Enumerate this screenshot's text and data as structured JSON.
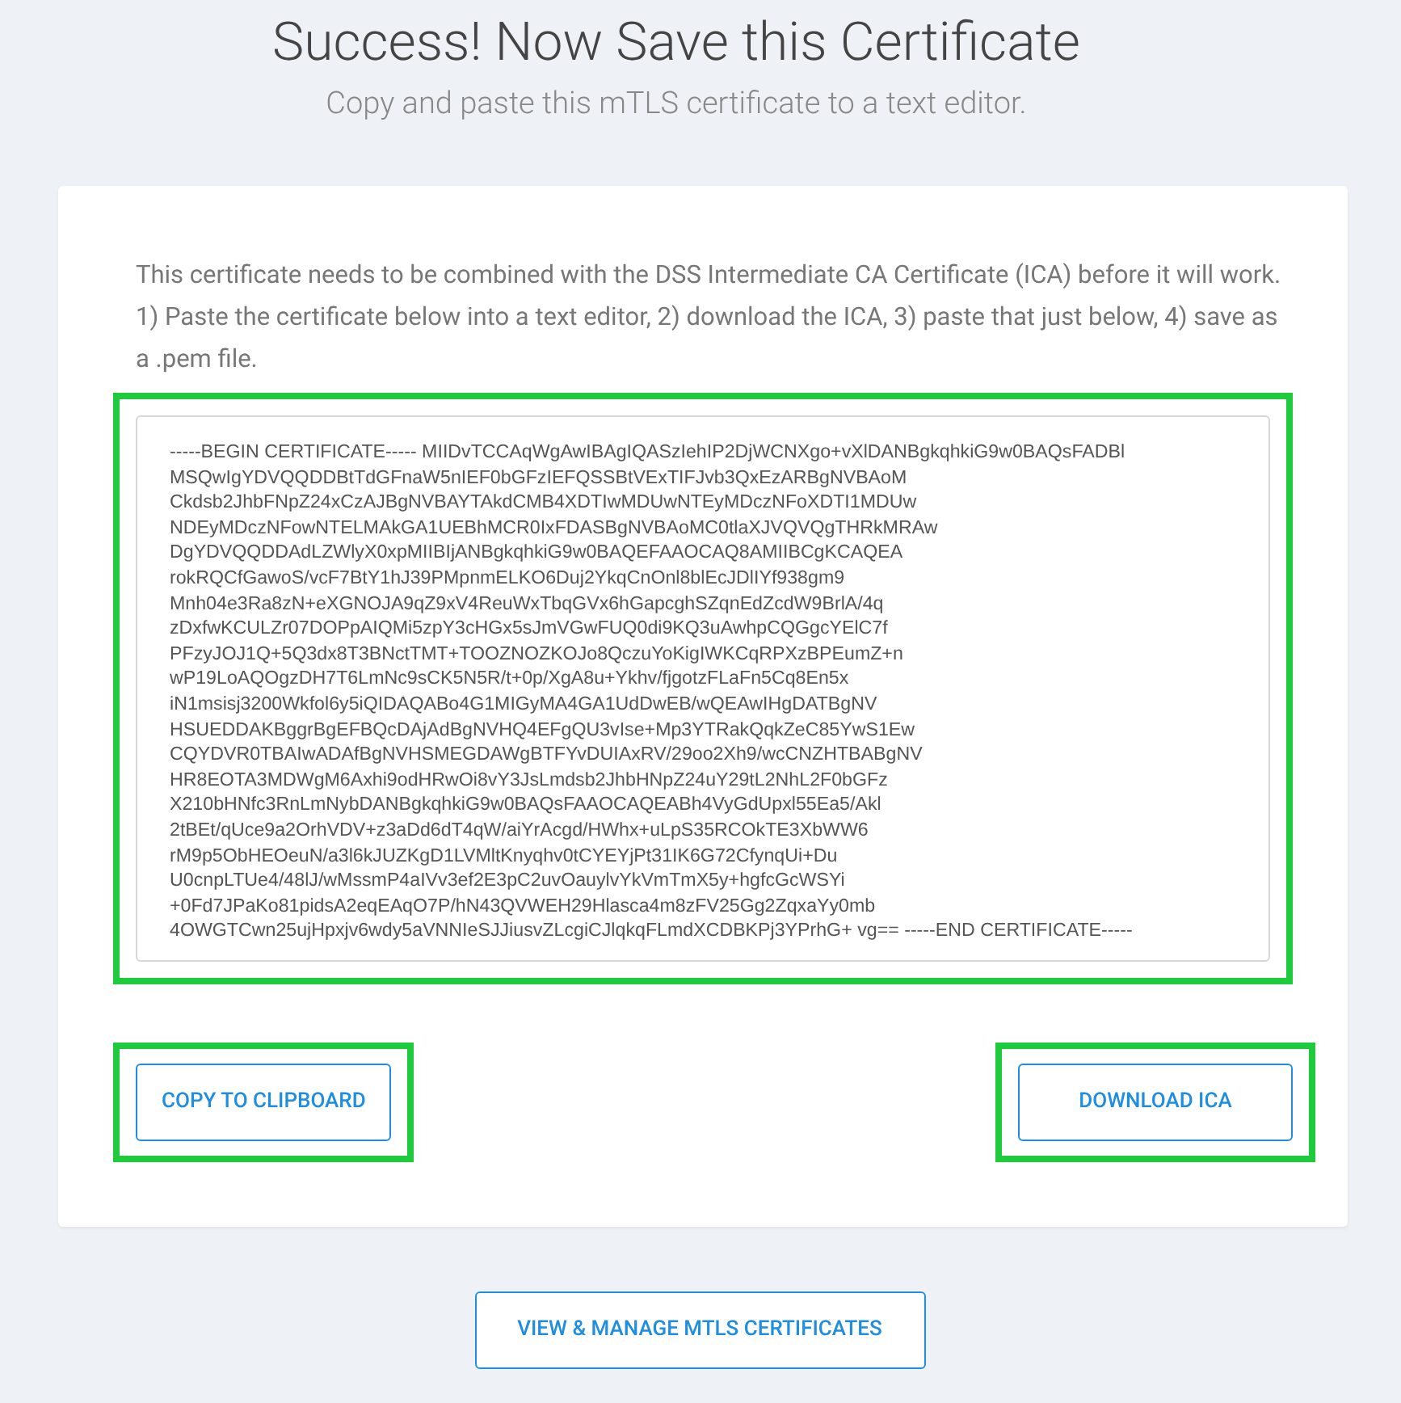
{
  "header": {
    "title": "Success! Now Save this Certificate",
    "subtitle": "Copy and paste this mTLS certificate to a text editor."
  },
  "card": {
    "instructions": [
      "This certificate needs to be combined with the DSS Intermediate CA Certificate (ICA) before it will work.",
      "1) Paste the certificate below into a text editor, 2) download the ICA, 3) paste that just below, 4) save as a .pem file."
    ],
    "certificate": {
      "highlighted": true,
      "lines": [
        "-----BEGIN CERTIFICATE----- MIIDvTCCAqWgAwIBAgIQASzIehIP2DjWCNXgo+vXlDANBgkqhkiG9w0BAQsFADBl",
        "MSQwIgYDVQQDDBtTdGFnaW5nIEF0bGFzIEFQSSBtVExTIFJvb3QxEzARBgNVBAoM",
        "Ckdsb2JhbFNpZ24xCzAJBgNVBAYTAkdCMB4XDTIwMDUwNTEyMDczNFoXDTI1MDUw",
        "NDEyMDczNFowNTELMAkGA1UEBhMCR0IxFDASBgNVBAoMC0tlaXJVQVQgTHRkMRAw",
        "DgYDVQQDDAdLZWlyX0xpMIIBIjANBgkqhkiG9w0BAQEFAAOCAQ8AMIIBCgKCAQEA",
        "rokRQCfGawoS/vcF7BtY1hJ39PMpnmELKO6Duj2YkqCnOnl8blEcJDlIYf938gm9",
        "Mnh04e3Ra8zN+eXGNOJA9qZ9xV4ReuWxTbqGVx6hGapcghSZqnEdZcdW9BrlA/4q",
        "zDxfwKCULZr07DOPpAIQMi5zpY3cHGx5sJmVGwFUQ0di9KQ3uAwhpCQGgcYElC7f",
        "PFzyJOJ1Q+5Q3dx8T3BNctTMT+TOOZNOZKOJo8QczuYoKigIWKCqRPXzBPEumZ+n",
        "wP19LoAQOgzDH7T6LmNc9sCK5N5R/t+0p/XgA8u+Ykhv/fjgotzFLaFn5Cq8En5x",
        "iN1msisj3200Wkfol6y5iQIDAQABo4G1MIGyMA4GA1UdDwEB/wQEAwIHgDATBgNV",
        "HSUEDDAKBggrBgEFBQcDAjAdBgNVHQ4EFgQU3vIse+Mp3YTRakQqkZeC85YwS1Ew",
        "CQYDVR0TBAIwADAfBgNVHSMEGDAWgBTFYvDUIAxRV/29oo2Xh9/wcCNZHTBABgNV",
        "HR8EOTA3MDWgM6Axhi9odHRwOi8vY3JsLmdsb2JhbHNpZ24uY29tL2NhL2F0bGFz",
        "X210bHNfc3RnLmNybDANBgkqhkiG9w0BAQsFAAOCAQEABh4VyGdUpxl55Ea5/Akl",
        "2tBEt/qUce9a2OrhVDV+z3aDd6dT4qW/aiYrAcgd/HWhx+uLpS35RCOkTE3XbWW6",
        "rM9p5ObHEOeuN/a3l6kJUZKgD1LVMltKnyqhv0tCYEYjPt31IK6G72CfynqUi+Du",
        "U0cnpLTUe4/48lJ/wMssmP4aIVv3ef2E3pC2uvOauylvYkVmTmX5y+hgfcGcWSYi",
        "+0Fd7JPaKo81pidsA2eqEAqO7P/hN43QVWEH29Hlasca4m8zFV25Gg2ZqxaYy0mb",
        "4OWGTCwn25ujHpxjv6wdy5aVNNIeSJJiusvZLcgiCJlqkqFLmdXCDBKPj3YPrhG+ vg== -----END CERTIFICATE-----"
      ]
    },
    "buttons": [
      {
        "label": "COPY TO CLIPBOARD",
        "highlighted": true
      },
      {
        "label": "DOWNLOAD ICA",
        "highlighted": true
      }
    ]
  },
  "footer_button": {
    "label": "VIEW & MANAGE MTLS CERTIFICATES"
  }
}
